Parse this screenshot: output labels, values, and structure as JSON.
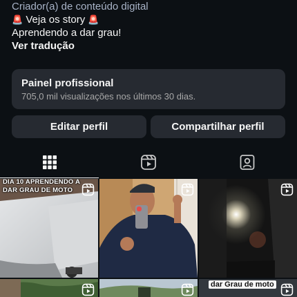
{
  "bio": {
    "category": "Criador(a) de conteúdo digital",
    "line_story": "Veja os story",
    "line_grau": "Aprendendo a dar grau!",
    "translate_label": "Ver tradução"
  },
  "panel": {
    "title": "Painel profissional",
    "subtitle": "705,0 mil visualizações nos últimos 30 dias."
  },
  "buttons": {
    "edit_label": "Editar perfil",
    "share_label": "Compartilhar perfil"
  },
  "tabs": {
    "items": [
      {
        "name": "grid",
        "icon": "grid-icon",
        "active": true
      },
      {
        "name": "reels",
        "icon": "reels-icon",
        "active": false
      },
      {
        "name": "tagged",
        "icon": "tagged-icon",
        "active": false
      }
    ]
  },
  "grid": {
    "posts": [
      {
        "caption_line1": "DIA 10 APRENDENDO A",
        "caption_line2": "DAR GRAU DE MOTO",
        "type": "reel"
      },
      {
        "type": "reel"
      },
      {
        "type": "reel"
      },
      {
        "type": "reel"
      },
      {
        "type": "reel"
      },
      {
        "caption": "dar Grau de moto",
        "type": "reel"
      }
    ]
  },
  "colors": {
    "background": "#0c1014",
    "surface": "#262a31",
    "category": "#a8b3c7",
    "muted": "#a8a8a8"
  }
}
